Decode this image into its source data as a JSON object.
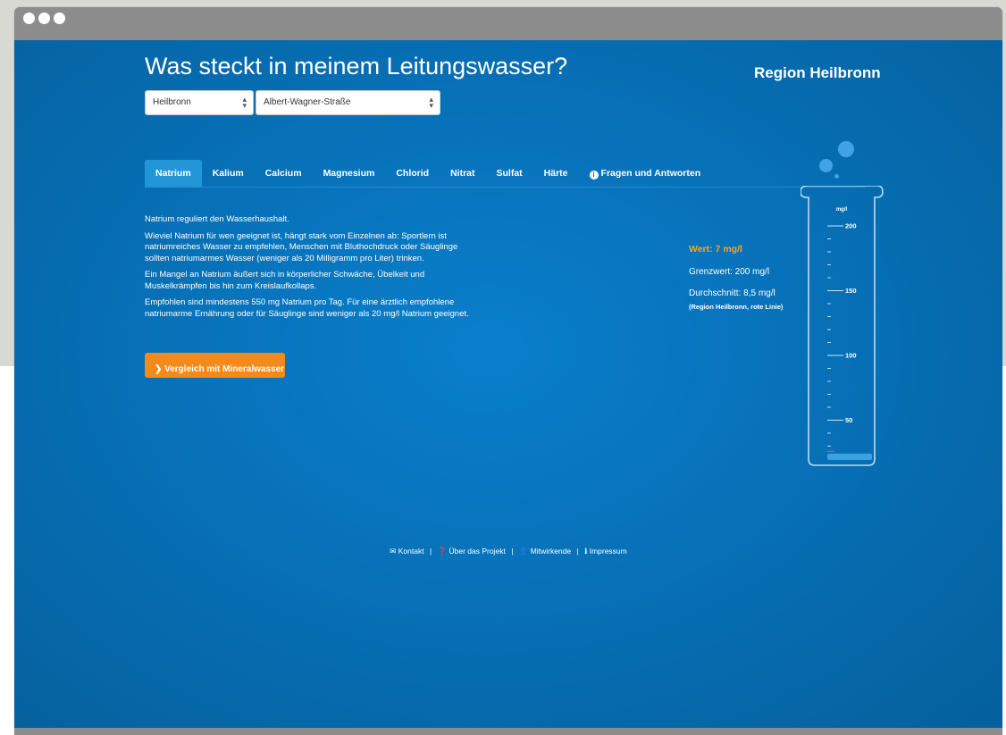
{
  "header": {
    "title": "Was steckt in meinem Leitungswasser?",
    "region": "Region Heilbronn"
  },
  "selects": {
    "city": "Heilbronn",
    "street": "Albert-Wagner-Straße"
  },
  "tabs": [
    {
      "label": "Natrium",
      "active": true
    },
    {
      "label": "Kalium"
    },
    {
      "label": "Calcium"
    },
    {
      "label": "Magnesium"
    },
    {
      "label": "Chlorid"
    },
    {
      "label": "Nitrat"
    },
    {
      "label": "Sulfat"
    },
    {
      "label": "Härte"
    },
    {
      "label": "Fragen und Antworten",
      "icon": "info-icon"
    }
  ],
  "content": {
    "intro": "Natrium reguliert den Wasserhaushalt.",
    "p1": "Wieviel Natrium für wen geeignet ist, hängt stark vom Einzelnen ab: Sportlern ist natriumreiches Wasser zu empfehlen, Menschen mit Bluthochdruck oder Säuglinge sollten natriumarmes Wasser (weniger als 20 Milligramm pro Liter) trinken.",
    "p2": "Ein Mangel an Natrium äußert sich in körperlicher Schwäche, Übelkeit und Muskelkrämpfen bis hin zum Kreislaufkollaps.",
    "p3": "Empfohlen sind mindestens 550 mg Natrium pro Tag. Für eine ärztlich empfohlene natriumarme Ernährung oder für Säuglinge sind weniger als 20 mg/l Natrium geeignet.",
    "compare_button": "Vergleich mit Mineralwasser"
  },
  "values": {
    "wert": "Wert: 7 mg/l",
    "grenzwert": "Grenzwert: 200 mg/l",
    "durchschnitt": "Durchschnitt: 8,5 mg/l",
    "durchschnitt_note": "(Region Heilbronn, rote Linie)"
  },
  "gauge": {
    "unit": "mg/l",
    "max": 200,
    "ticks": [
      "200",
      "150",
      "100",
      "50"
    ],
    "value": 7,
    "average": 8.5,
    "fill_color": "#3aa0e0",
    "average_color": "#e05a3a"
  },
  "footer": {
    "kontakt": "Kontakt",
    "projekt": "Über das Projekt",
    "mitwirkende": "Mitwirkende",
    "impressum": "Impressum"
  },
  "colors": {
    "background": "#0771b8",
    "accent_orange": "#f58a18",
    "value_orange": "#f5a623",
    "active_tab": "#2396d8"
  }
}
